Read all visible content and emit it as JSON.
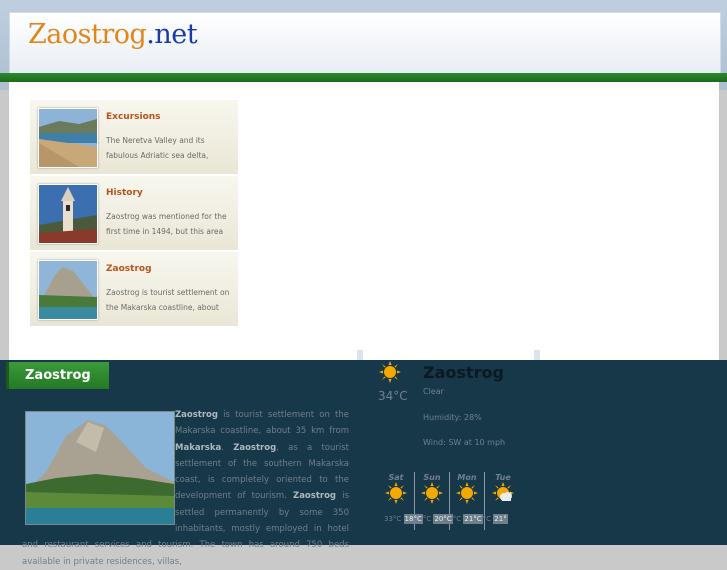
{
  "site": {
    "logo_main": "Zaostrog",
    "logo_tld": ".net"
  },
  "colors": {
    "accent_orange": "#b8541a",
    "nav_green": "#2c8a2c",
    "panel_dark": "#173848"
  },
  "articles": [
    {
      "title": "Excursions",
      "desc": "The Neretva Valley and its fabulous Adriatic sea delta,",
      "icon": "beach-photo"
    },
    {
      "title": "History",
      "desc": "Zaostrog was mentioned for the first time in 1494, but this area",
      "icon": "church-tower-photo"
    },
    {
      "title": "Zaostrog",
      "desc": "Zaostrog is tourist settlement on the Makarska coastline, about",
      "icon": "mountain-coast-photo"
    }
  ],
  "section": {
    "title": "Zaostrog"
  },
  "body": {
    "b1": "Zaostrog",
    "t1": " is tourist settlement on the Makarska coastline, about 35 km from ",
    "b2": "Makarska",
    "t2": ". ",
    "b3": "Zaostrog",
    "t3": ", as a tourist settlement of the southern Makarska coast, is completely oriented to the development of tourism. ",
    "b4": "Zaostrog",
    "t4": " is settled permanently by some 350 inhabitants, mostly employed in hotel and restaurant services and tourism. The town has around 750 beds available in private residences, villas,"
  },
  "weather": {
    "city": "Zaostrog",
    "temp": "34°C",
    "condition": "Clear",
    "humidity": "Humidity: 28%",
    "wind": "Wind: SW at 10 mph",
    "forecast": [
      {
        "day": "Sat",
        "icon": "sun-icon"
      },
      {
        "day": "Sun",
        "icon": "sun-icon"
      },
      {
        "day": "Mon",
        "icon": "sun-icon"
      },
      {
        "day": "Tue",
        "icon": "sun-cloud-icon"
      }
    ],
    "temps": {
      "t1": "33°C",
      "t2": "18°C",
      "t3": "°C",
      "t4": "20°C",
      "t5": "°C",
      "t6": "21°C",
      "t7": "°C",
      "t8": "21°"
    }
  }
}
